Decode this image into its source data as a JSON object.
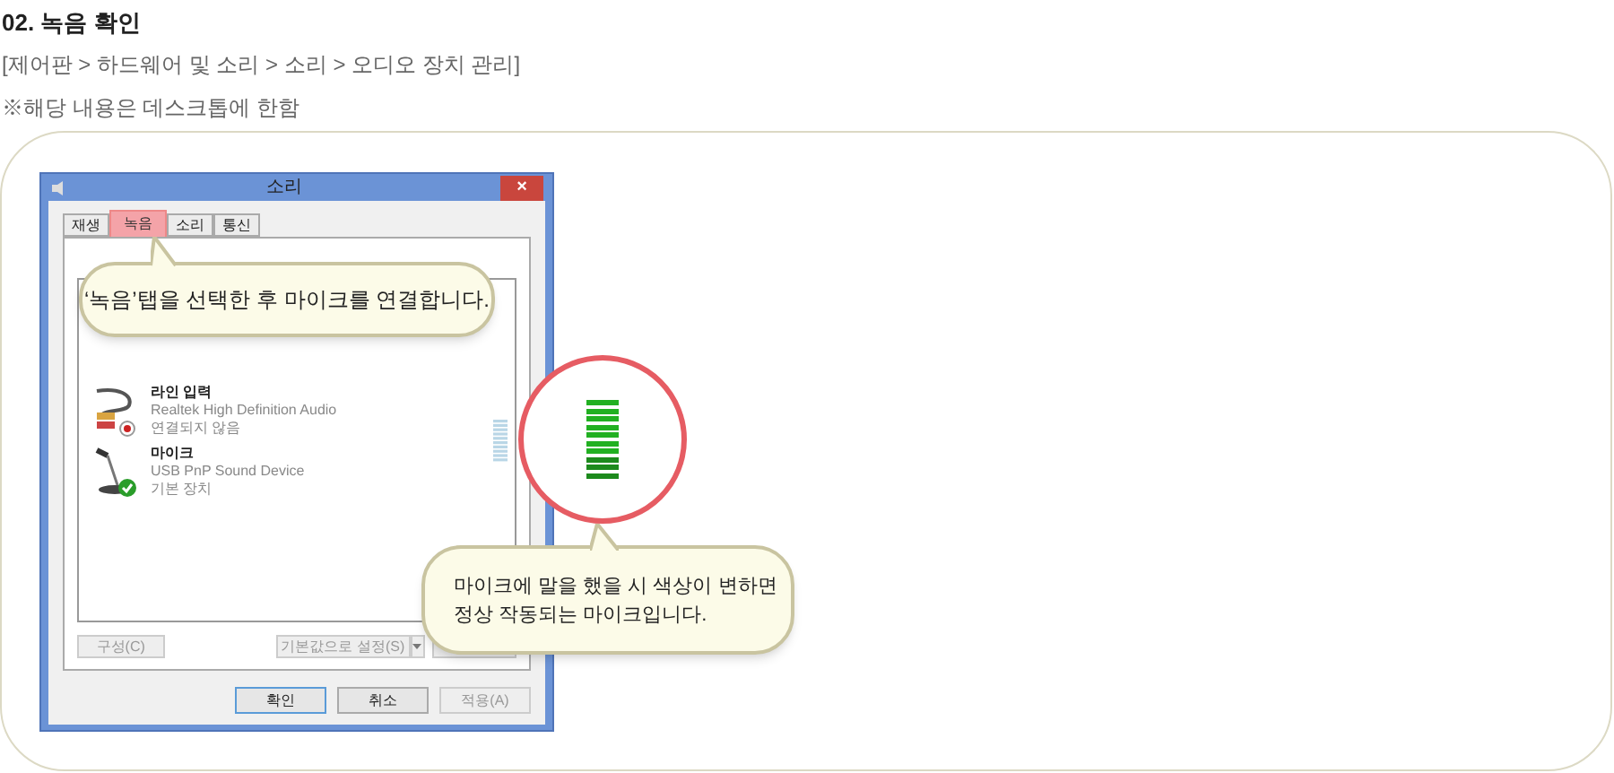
{
  "heading": "02. 녹음 확인",
  "path": "[제어판 > 하드웨어 및 소리 > 소리 > 오디오 장치 관리]",
  "note": "※해당 내용은 데스크톱에 한함",
  "dialog": {
    "title": "소리",
    "close": "×",
    "tabs": [
      {
        "label": "재생",
        "selected": false
      },
      {
        "label": "녹음",
        "selected": true
      },
      {
        "label": "소리",
        "selected": false
      },
      {
        "label": "통신",
        "selected": false
      }
    ],
    "devices": [
      {
        "kind": "line",
        "name": "라인 입력",
        "driver": "Realtek High Definition Audio",
        "status": "연결되지 않음"
      },
      {
        "kind": "mic",
        "name": "마이크",
        "driver": "USB PnP Sound Device",
        "status": "기본 장치"
      }
    ],
    "panel_buttons": [
      {
        "label": "구성(C)",
        "disabled": true
      },
      {
        "label": "기본값으로 설정(S)",
        "disabled": true
      }
    ],
    "buttons": [
      {
        "label": "확인",
        "disabled": false
      },
      {
        "label": "취소",
        "disabled": false
      },
      {
        "label": "적용(A)",
        "disabled": true
      }
    ]
  },
  "callouts": [
    {
      "text": "‘녹음’탭을 선택한 후 마이크를 연결합니다."
    },
    {
      "text": "마이크에 말을 했을 시 색상이 변하면\n정상 작동되는 마이크입니다."
    }
  ]
}
